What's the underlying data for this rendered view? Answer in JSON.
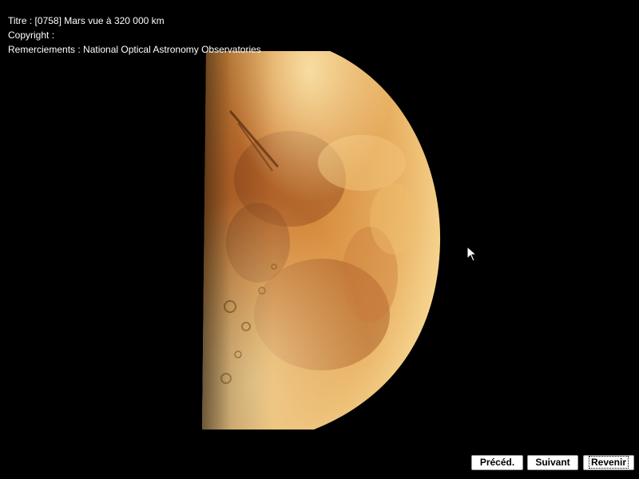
{
  "caption": {
    "title": "Titre : [0758] Mars vue à 320 000 km",
    "copyright": "Copyright :",
    "credits": "Remerciements : National Optical Astronomy Observatories"
  },
  "image": {
    "subject": "mars-half-phase",
    "colors": {
      "bright": "#f6dd98",
      "mid": "#d4873a",
      "dark": "#8a4a1c",
      "background": "#000000"
    }
  },
  "nav": {
    "prev_label": "Précéd.",
    "next_label": "Suivant",
    "back_label": "Revenir"
  }
}
